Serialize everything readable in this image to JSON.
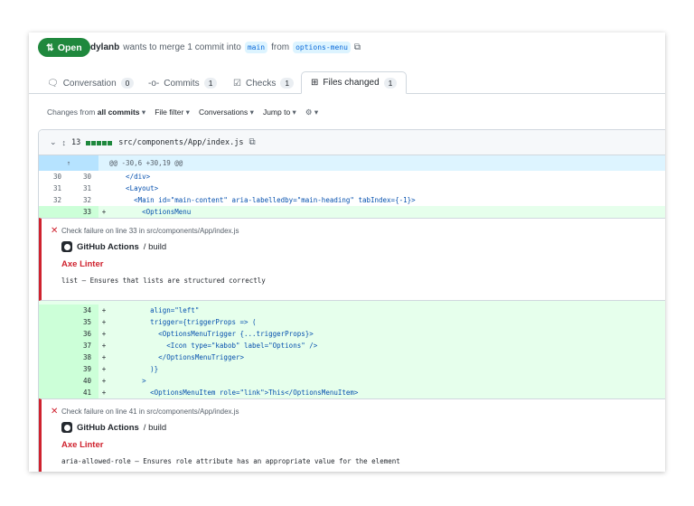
{
  "pr": {
    "state": "Open",
    "author": "dylanb",
    "merge_text": "wants to merge 1 commit into",
    "base": "main",
    "from_text": "from",
    "head": "options-menu"
  },
  "tabs": [
    {
      "label": "Conversation",
      "count": "0"
    },
    {
      "label": "Commits",
      "count": "1"
    },
    {
      "label": "Checks",
      "count": "1"
    },
    {
      "label": "Files changed",
      "count": "1"
    }
  ],
  "toolbar": {
    "changes_prefix": "Changes from",
    "changes_value": "all commits",
    "file_filter": "File filter",
    "conversations": "Conversations",
    "jump_to": "Jump to"
  },
  "file": {
    "changes": "13",
    "path": "src/components/App/index.js",
    "hunk": "@@ -30,6 +30,19 @@"
  },
  "lines_a": [
    {
      "old": "30",
      "new": "30",
      "sign": "",
      "code": "    </div>",
      "type": "ctx"
    },
    {
      "old": "31",
      "new": "31",
      "sign": "",
      "code": "    <Layout>",
      "type": "ctx"
    },
    {
      "old": "32",
      "new": "32",
      "sign": "",
      "code": "      <Main id=\"main-content\" aria-labelledby=\"main-heading\" tabIndex={-1}>",
      "type": "ctx"
    },
    {
      "old": "",
      "new": "33",
      "sign": "+",
      "code": "        <OptionsMenu",
      "type": "add"
    }
  ],
  "lines_b": [
    {
      "old": "",
      "new": "34",
      "sign": "+",
      "code": "          align=\"left\"",
      "type": "add"
    },
    {
      "old": "",
      "new": "35",
      "sign": "+",
      "code": "          trigger={triggerProps => (",
      "type": "add"
    },
    {
      "old": "",
      "new": "36",
      "sign": "+",
      "code": "            <OptionsMenuTrigger {...triggerProps}>",
      "type": "add"
    },
    {
      "old": "",
      "new": "37",
      "sign": "+",
      "code": "              <Icon type=\"kabob\" label=\"Options\" />",
      "type": "add"
    },
    {
      "old": "",
      "new": "38",
      "sign": "+",
      "code": "            </OptionsMenuTrigger>",
      "type": "add"
    },
    {
      "old": "",
      "new": "39",
      "sign": "+",
      "code": "          )}",
      "type": "add"
    },
    {
      "old": "",
      "new": "40",
      "sign": "+",
      "code": "        >",
      "type": "add"
    },
    {
      "old": "",
      "new": "41",
      "sign": "+",
      "code": "          <OptionsMenuItem role=\"link\">This</OptionsMenuItem>",
      "type": "add"
    }
  ],
  "annotations": [
    {
      "title": "Check failure on line 33 in src/components/App/index.js",
      "app": "GitHub Actions",
      "job": "/ build",
      "linter": "Axe Linter",
      "message": "list – Ensures that lists are structured correctly"
    },
    {
      "title": "Check failure on line 41 in src/components/App/index.js",
      "app": "GitHub Actions",
      "job": "/ build",
      "linter": "Axe Linter",
      "message": "aria-allowed-role – Ensures role attribute has an appropriate value for the element"
    }
  ]
}
